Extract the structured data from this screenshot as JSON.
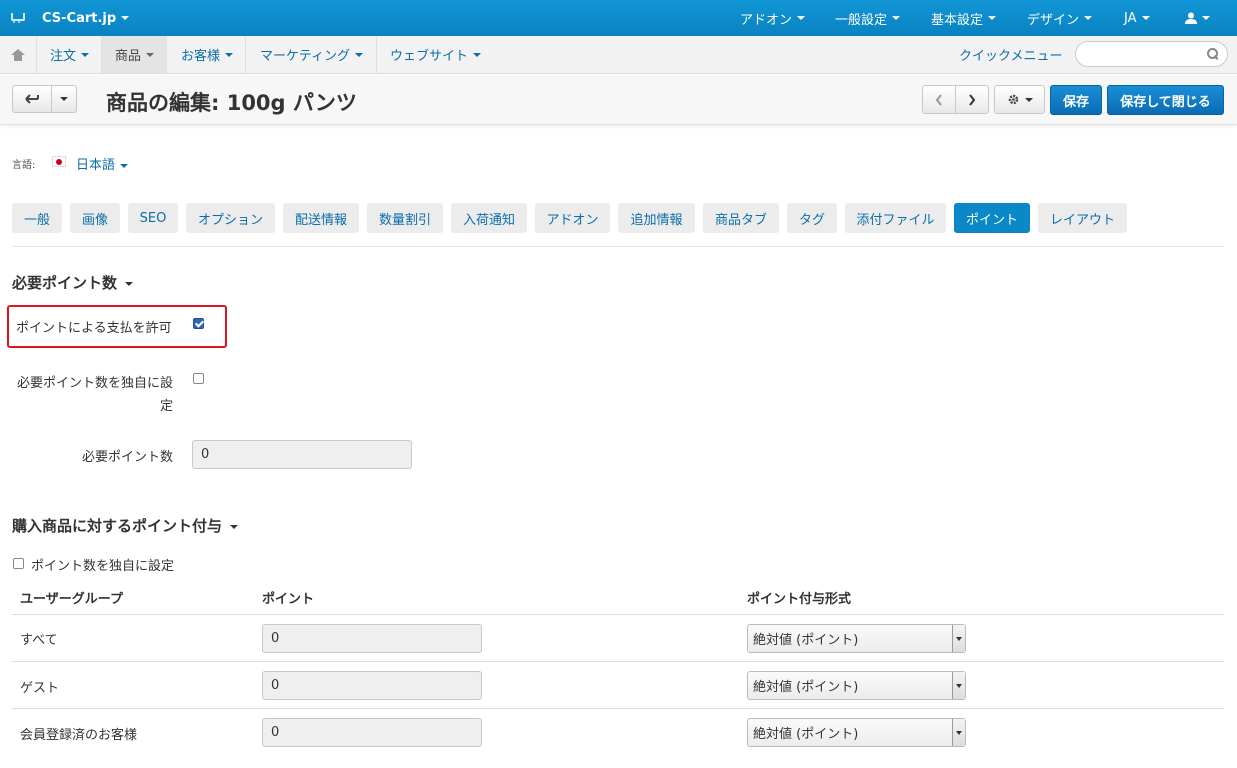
{
  "topbar": {
    "brand": "CS-Cart.jp",
    "menu": [
      "アドオン",
      "一般設定",
      "基本設定",
      "デザイン",
      "JA"
    ]
  },
  "secondary_nav": {
    "items": [
      "注文",
      "商品",
      "お客様",
      "マーケティング",
      "ウェブサイト"
    ],
    "active": "商品",
    "quick_menu": "クイックメニュー",
    "search_placeholder": ""
  },
  "toolbar": {
    "title": "商品の編集: 100g パンツ",
    "save_label": "保存",
    "save_close_label": "保存して閉じる"
  },
  "language": {
    "label": "言語:",
    "value": "日本語"
  },
  "tabs": {
    "items": [
      "一般",
      "画像",
      "SEO",
      "オプション",
      "配送情報",
      "数量割引",
      "入荷通知",
      "アドオン",
      "追加情報",
      "商品タブ",
      "タグ",
      "添付ファイル",
      "ポイント",
      "レイアウト"
    ],
    "active": "ポイント"
  },
  "required_points": {
    "title": "必要ポイント数",
    "allow_pay_label": "ポイントによる支払を許可",
    "allow_pay_checked": true,
    "override_label_1": "必要ポイント数を独自に設",
    "override_label_2": "定",
    "override_checked": false,
    "points_label": "必要ポイント数",
    "points_value": "0"
  },
  "earned_points": {
    "title": "購入商品に対するポイント付与",
    "override_label": "ポイント数を独自に設定",
    "override_checked": false,
    "columns": [
      "ユーザーグループ",
      "ポイント",
      "ポイント付与形式"
    ],
    "rows": [
      {
        "group": "すべて",
        "points": "0",
        "type": "絶対値 (ポイント)"
      },
      {
        "group": "ゲスト",
        "points": "0",
        "type": "絶対値 (ポイント)"
      },
      {
        "group": "会員登録済のお客様",
        "points": "0",
        "type": "絶対値 (ポイント)"
      }
    ]
  },
  "colors": {
    "accent": "#0a88c8",
    "primary_button": "#0a6cb5",
    "highlight_border": "#e0141e"
  }
}
